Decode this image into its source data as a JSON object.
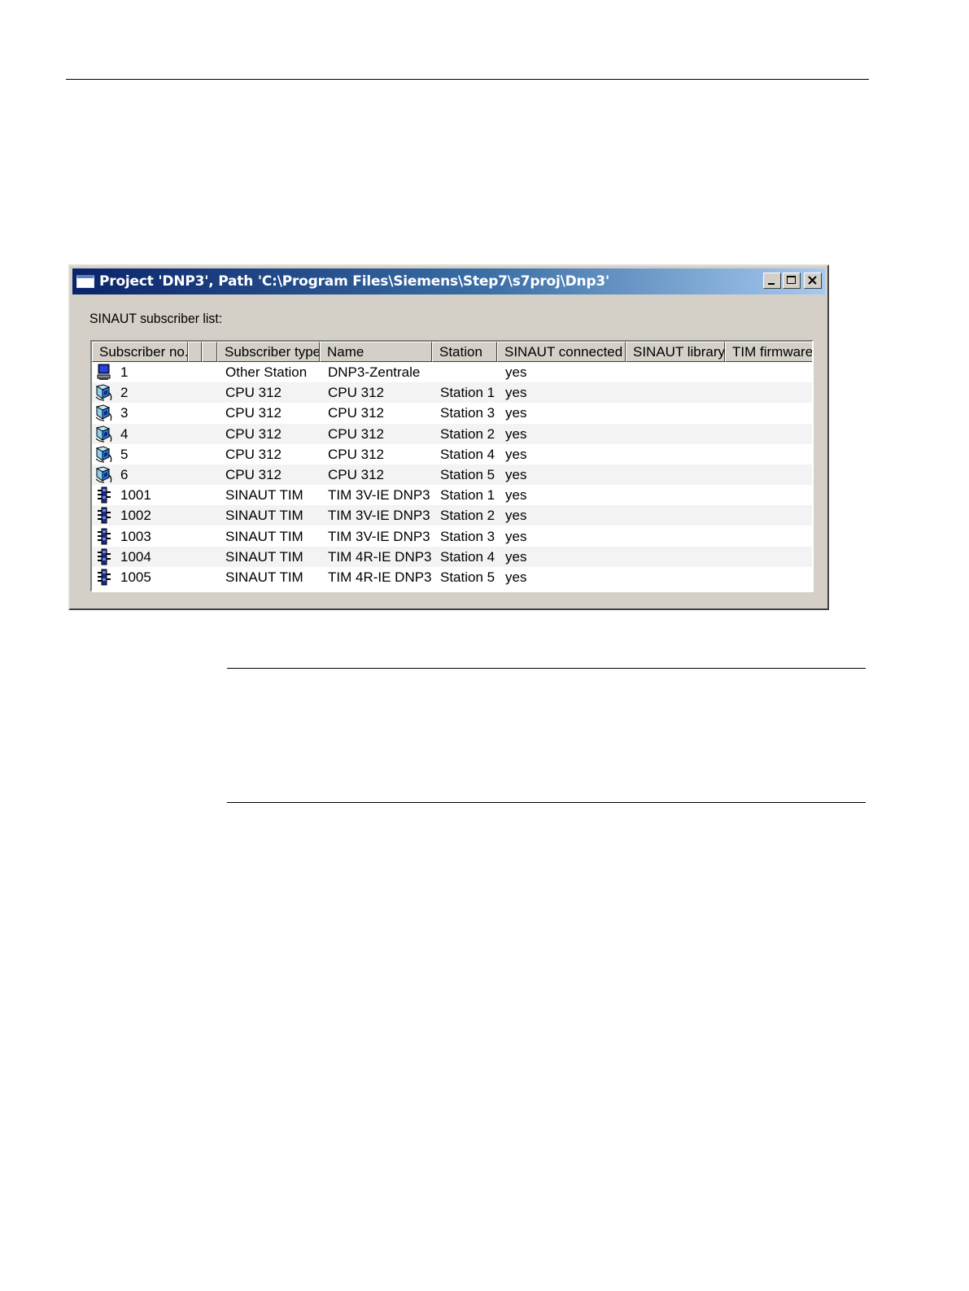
{
  "window": {
    "title": "Project 'DNP3', Path 'C:\\Program Files\\Siemens\\Step7\\s7proj\\Dnp3'",
    "list_label": "SINAUT subscriber list:"
  },
  "table": {
    "columns": [
      {
        "label": "Subscriber no."
      },
      {
        "label": ""
      },
      {
        "label": ""
      },
      {
        "label": "Subscriber type"
      },
      {
        "label": "Name"
      },
      {
        "label": "Station"
      },
      {
        "label": "SINAUT connected"
      },
      {
        "label": "SINAUT library"
      },
      {
        "label": "TIM firmware"
      }
    ],
    "rows": [
      {
        "icon": "computer-icon",
        "no": "1",
        "type": "Other Station",
        "name": "DNP3-Zentrale",
        "station": "",
        "connected": "yes"
      },
      {
        "icon": "cpu-icon",
        "no": "2",
        "type": "CPU 312",
        "name": "CPU 312",
        "station": "Station 1",
        "connected": "yes"
      },
      {
        "icon": "cpu-icon",
        "no": "3",
        "type": "CPU 312",
        "name": "CPU 312",
        "station": "Station 3",
        "connected": "yes"
      },
      {
        "icon": "cpu-icon",
        "no": "4",
        "type": "CPU 312",
        "name": "CPU 312",
        "station": "Station 2",
        "connected": "yes"
      },
      {
        "icon": "cpu-icon",
        "no": "5",
        "type": "CPU 312",
        "name": "CPU 312",
        "station": "Station 4",
        "connected": "yes"
      },
      {
        "icon": "cpu-icon",
        "no": "6",
        "type": "CPU 312",
        "name": "CPU 312",
        "station": "Station 5",
        "connected": "yes"
      },
      {
        "icon": "tim-module-icon",
        "no": "1001",
        "type": "SINAUT TIM",
        "name": "TIM 3V-IE DNP3",
        "station": "Station 1",
        "connected": "yes"
      },
      {
        "icon": "tim-module-icon",
        "no": "1002",
        "type": "SINAUT TIM",
        "name": "TIM 3V-IE DNP3",
        "station": "Station 2",
        "connected": "yes"
      },
      {
        "icon": "tim-module-icon",
        "no": "1003",
        "type": "SINAUT TIM",
        "name": "TIM 3V-IE DNP3",
        "station": "Station 3",
        "connected": "yes"
      },
      {
        "icon": "tim-module-icon",
        "no": "1004",
        "type": "SINAUT TIM",
        "name": "TIM 4R-IE DNP3",
        "station": "Station 4",
        "connected": "yes"
      },
      {
        "icon": "tim-module-icon",
        "no": "1005",
        "type": "SINAUT TIM",
        "name": "TIM 4R-IE DNP3",
        "station": "Station 5",
        "connected": "yes"
      }
    ]
  }
}
